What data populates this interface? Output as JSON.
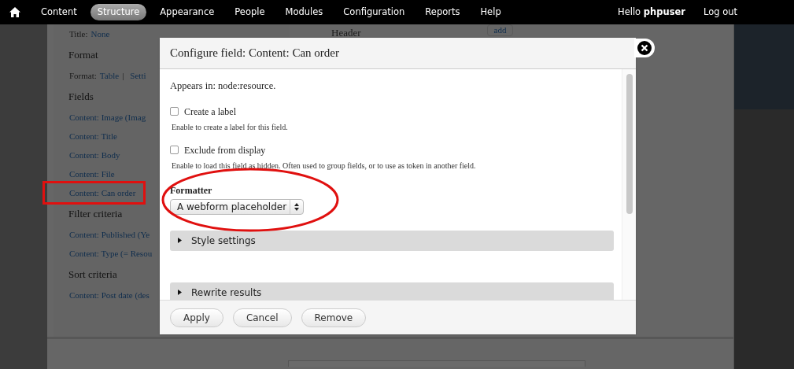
{
  "toolbar": {
    "items": [
      {
        "label": "Content",
        "selected": false
      },
      {
        "label": "Structure",
        "selected": true
      },
      {
        "label": "Appearance",
        "selected": false
      },
      {
        "label": "People",
        "selected": false
      },
      {
        "label": "Modules",
        "selected": false
      },
      {
        "label": "Configuration",
        "selected": false
      },
      {
        "label": "Reports",
        "selected": false
      },
      {
        "label": "Help",
        "selected": false
      }
    ],
    "greeting": "Hello **phpuser**",
    "logout": "Log out"
  },
  "page": {
    "sections": [
      {
        "links": [
          {
            "prefix": "Title:",
            "label": "None"
          }
        ]
      },
      {
        "heading": "Format",
        "links": [
          {
            "prefix": "Format:",
            "label": "Table",
            "suffix": "|",
            "extra": "Setti"
          }
        ]
      },
      {
        "heading": "Fields",
        "links": [
          {
            "label": "Content: Image (Imag"
          },
          {
            "label": "Content: Title"
          },
          {
            "label": "Content: Body"
          },
          {
            "label": "Content: File"
          },
          {
            "label": "Content: Can order",
            "highlighted": true
          }
        ]
      },
      {
        "heading": "Filter criteria",
        "links": [
          {
            "label": "Content: Published (Ye"
          },
          {
            "label": "Content: Type (= Resou"
          }
        ]
      },
      {
        "heading": "Sort criteria",
        "links": [
          {
            "label": "Content: Post date (des"
          }
        ]
      }
    ],
    "header_label": "Header",
    "add_button": "add"
  },
  "dialog": {
    "title": "Configure field: Content: Can order",
    "appears_in": "Appears in: node:resource.",
    "options": [
      {
        "label": "Create a label",
        "checked": false,
        "description": "Enable to create a label for this field."
      },
      {
        "label": "Exclude from display",
        "checked": false,
        "description": "Enable to load this field as hidden. Often used to group fields, or to use as token in another field."
      }
    ],
    "formatter": {
      "label": "Formatter",
      "value": "A webform placeholder",
      "highlighted": true
    },
    "fieldsets": [
      {
        "label": "Style settings",
        "expanded": false
      },
      {
        "label": "Rewrite results",
        "expanded": false
      }
    ],
    "buttons": [
      "Apply",
      "Cancel",
      "Remove"
    ]
  }
}
